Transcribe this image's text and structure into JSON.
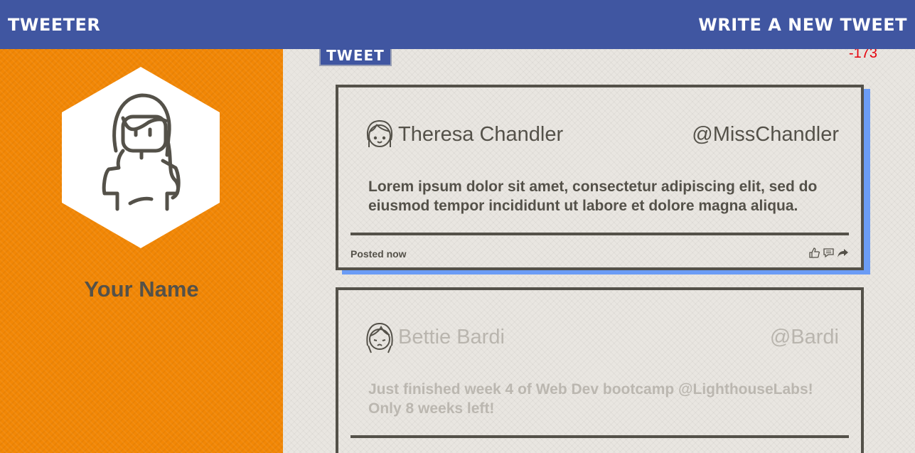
{
  "nav": {
    "brand": "TWEETER",
    "compose": "WRITE A NEW TWEET"
  },
  "profile": {
    "name": "Your Name"
  },
  "composer": {
    "label": "TWEET",
    "counter": "-173"
  },
  "tweets": [
    {
      "name": "Theresa Chandler",
      "handle": "@MissChandler",
      "text": "Lorem ipsum dolor sit amet, consectetur adipiscing elit, sed do eiusmod tempor incididunt ut labore et dolore magna aliqua.",
      "posted": "Posted now"
    },
    {
      "name": "Bettie Bardi",
      "handle": "@Bardi",
      "text": "Just finished week 4 of Web Dev bootcamp @LighthouseLabs! Only 8 weeks left!",
      "posted": ""
    }
  ],
  "colors": {
    "nav": "#4056a1",
    "sidebar": "#f28705",
    "text": "#545149",
    "counter_negative": "#e5000b",
    "shadow": "#6b9cf5"
  }
}
